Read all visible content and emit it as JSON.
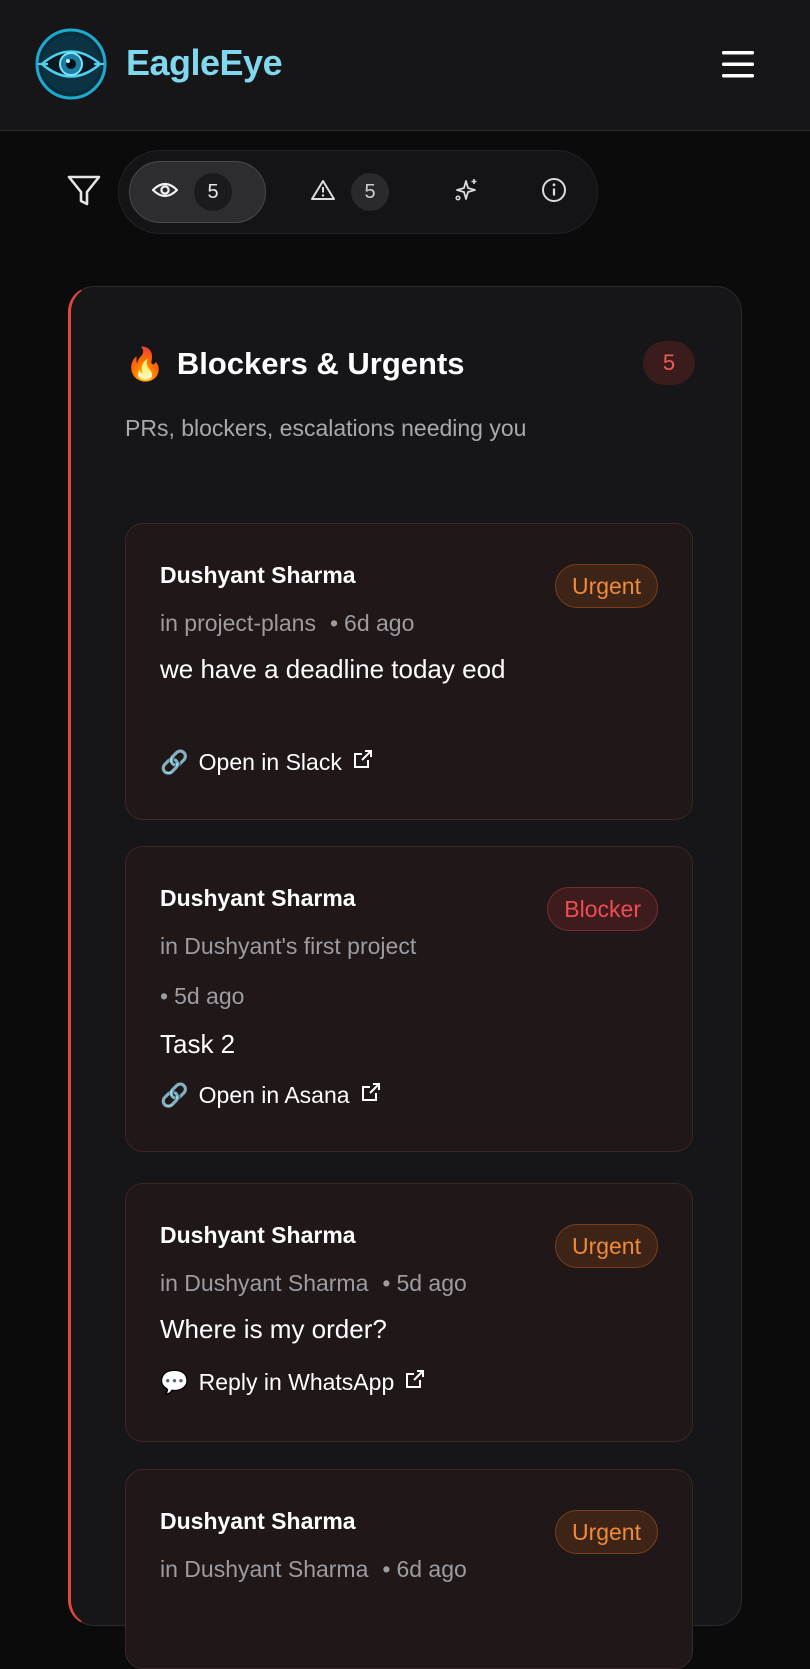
{
  "app": {
    "name": "EagleEye"
  },
  "tabs": [
    {
      "key": "watch",
      "count": "5",
      "icon": "eye-icon"
    },
    {
      "key": "alerts",
      "count": "5",
      "icon": "warning-icon"
    },
    {
      "key": "sparkle",
      "icon": "sparkle-icon"
    },
    {
      "key": "info",
      "icon": "info-icon"
    }
  ],
  "panel": {
    "emoji": "🔥",
    "title": "Blockers & Urgents",
    "count": "5",
    "subtitle": "PRs, blockers, escalations needing you"
  },
  "cards": [
    {
      "name": "Dushyant Sharma",
      "badge": "Urgent",
      "meta_in": "in project-plans",
      "meta_time": "6d ago",
      "text": "we have a deadline today eod",
      "link_icon": "🔗",
      "link": "Open in Slack"
    },
    {
      "name": "Dushyant Sharma",
      "badge": "Blocker",
      "meta_in": "in Dushyant's first project",
      "meta_time": "5d ago",
      "text": "Task 2",
      "link_icon": "🔗",
      "link": "Open in Asana"
    },
    {
      "name": "Dushyant Sharma",
      "badge": "Urgent",
      "meta_in": "in Dushyant Sharma",
      "meta_time": "5d ago",
      "text": "Where is my order?",
      "link_icon": "💬",
      "link": "Reply in WhatsApp"
    },
    {
      "name": "Dushyant Sharma",
      "badge": "Urgent",
      "meta_in": "in Dushyant Sharma",
      "meta_time": "6d ago"
    }
  ],
  "colors": {
    "accent": "#7fd8ee",
    "urgent": "#f08a3b",
    "blocker": "#f04d52",
    "panel_border": "#e2463f"
  }
}
